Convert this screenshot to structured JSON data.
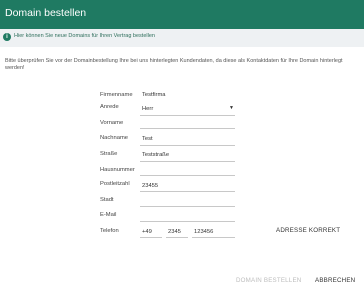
{
  "dialog": {
    "title": "Domain bestellen",
    "info_text": "Hier können Sie neue Domains für Ihren Vertrag bestellen",
    "warning_text": "Bitte überprüfen Sie vor der Domainbestellung Ihre bei uns hinterlegten Kundendaten, da diese als Kontaktdaten für Ihre Domain hinterlegt werden!"
  },
  "form": {
    "firmenname": {
      "label": "Firmenname",
      "value": "Testfirma"
    },
    "anrede": {
      "label": "Anrede",
      "value": "Herr"
    },
    "vorname": {
      "label": "Vorname",
      "value": ""
    },
    "nachname": {
      "label": "Nachname",
      "value": "Test"
    },
    "strasse": {
      "label": "Straße",
      "value": "Teststraße"
    },
    "hausnummer": {
      "label": "Hausnummer",
      "value": ""
    },
    "postleitzahl": {
      "label": "Postleitzahl",
      "value": "23455"
    },
    "stadt": {
      "label": "Stadt",
      "value": ""
    },
    "email": {
      "label": "E-Mail",
      "value": ""
    },
    "telefon": {
      "label": "Telefon",
      "country": "+49",
      "area": "2345",
      "number": "123456"
    }
  },
  "buttons": {
    "adresse_korrekt": "ADRESSE KORREKT",
    "domain_bestellen": "DOMAIN BESTELLEN",
    "abbrechen": "ABBRECHEN"
  },
  "colors": {
    "header": "#1f7a62",
    "info_background": "#eef1f3",
    "disabled_text": "#bdbdbd"
  }
}
